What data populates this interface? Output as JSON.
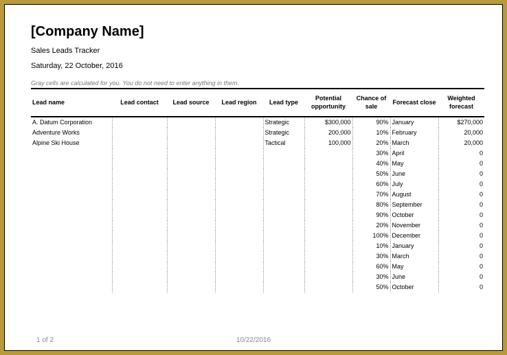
{
  "header": {
    "company": "[Company Name]",
    "subtitle": "Sales Leads Tracker",
    "date": "Saturday, 22 October, 2016",
    "note": "Gray cells are calculated for you. You do not need to enter anything in them."
  },
  "columns": {
    "name": "Lead   name",
    "contact": "Lead   contact",
    "source": "Lead   source",
    "region": "Lead   region",
    "type": "Lead   type",
    "opportunity": "Potential opportunity",
    "chance": "Chance of sale",
    "close": "Forecast close",
    "weighted": "Weighted forecast"
  },
  "rows": [
    {
      "name": "A. Datum Corporation",
      "contact": "",
      "source": "",
      "region": "",
      "type": "Strategic",
      "opportunity": "$300,000",
      "chance": "90%",
      "close": "January",
      "weighted": "$270,000"
    },
    {
      "name": "Adventure Works",
      "contact": "",
      "source": "",
      "region": "",
      "type": "Strategic",
      "opportunity": "200,000",
      "chance": "10%",
      "close": "February",
      "weighted": "20,000"
    },
    {
      "name": "Alpine Ski House",
      "contact": "",
      "source": "",
      "region": "",
      "type": "Tactical",
      "opportunity": "100,000",
      "chance": "20%",
      "close": "March",
      "weighted": "20,000"
    },
    {
      "name": "",
      "contact": "",
      "source": "",
      "region": "",
      "type": "",
      "opportunity": "",
      "chance": "30%",
      "close": "April",
      "weighted": "0"
    },
    {
      "name": "",
      "contact": "",
      "source": "",
      "region": "",
      "type": "",
      "opportunity": "",
      "chance": "40%",
      "close": "May",
      "weighted": "0"
    },
    {
      "name": "",
      "contact": "",
      "source": "",
      "region": "",
      "type": "",
      "opportunity": "",
      "chance": "50%",
      "close": "June",
      "weighted": "0"
    },
    {
      "name": "",
      "contact": "",
      "source": "",
      "region": "",
      "type": "",
      "opportunity": "",
      "chance": "60%",
      "close": "July",
      "weighted": "0"
    },
    {
      "name": "",
      "contact": "",
      "source": "",
      "region": "",
      "type": "",
      "opportunity": "",
      "chance": "70%",
      "close": "August",
      "weighted": "0"
    },
    {
      "name": "",
      "contact": "",
      "source": "",
      "region": "",
      "type": "",
      "opportunity": "",
      "chance": "80%",
      "close": "September",
      "weighted": "0"
    },
    {
      "name": "",
      "contact": "",
      "source": "",
      "region": "",
      "type": "",
      "opportunity": "",
      "chance": "90%",
      "close": "October",
      "weighted": "0"
    },
    {
      "name": "",
      "contact": "",
      "source": "",
      "region": "",
      "type": "",
      "opportunity": "",
      "chance": "20%",
      "close": "November",
      "weighted": "0"
    },
    {
      "name": "",
      "contact": "",
      "source": "",
      "region": "",
      "type": "",
      "opportunity": "",
      "chance": "100%",
      "close": "December",
      "weighted": "0"
    },
    {
      "name": "",
      "contact": "",
      "source": "",
      "region": "",
      "type": "",
      "opportunity": "",
      "chance": "10%",
      "close": "January",
      "weighted": "0"
    },
    {
      "name": "",
      "contact": "",
      "source": "",
      "region": "",
      "type": "",
      "opportunity": "",
      "chance": "30%",
      "close": "March",
      "weighted": "0"
    },
    {
      "name": "",
      "contact": "",
      "source": "",
      "region": "",
      "type": "",
      "opportunity": "",
      "chance": "60%",
      "close": "May",
      "weighted": "0"
    },
    {
      "name": "",
      "contact": "",
      "source": "",
      "region": "",
      "type": "",
      "opportunity": "",
      "chance": "30%",
      "close": "June",
      "weighted": "0"
    },
    {
      "name": "",
      "contact": "",
      "source": "",
      "region": "",
      "type": "",
      "opportunity": "",
      "chance": "50%",
      "close": "October",
      "weighted": "0"
    }
  ],
  "footer": {
    "page": "1 of 2",
    "date": "10/22/2016"
  }
}
